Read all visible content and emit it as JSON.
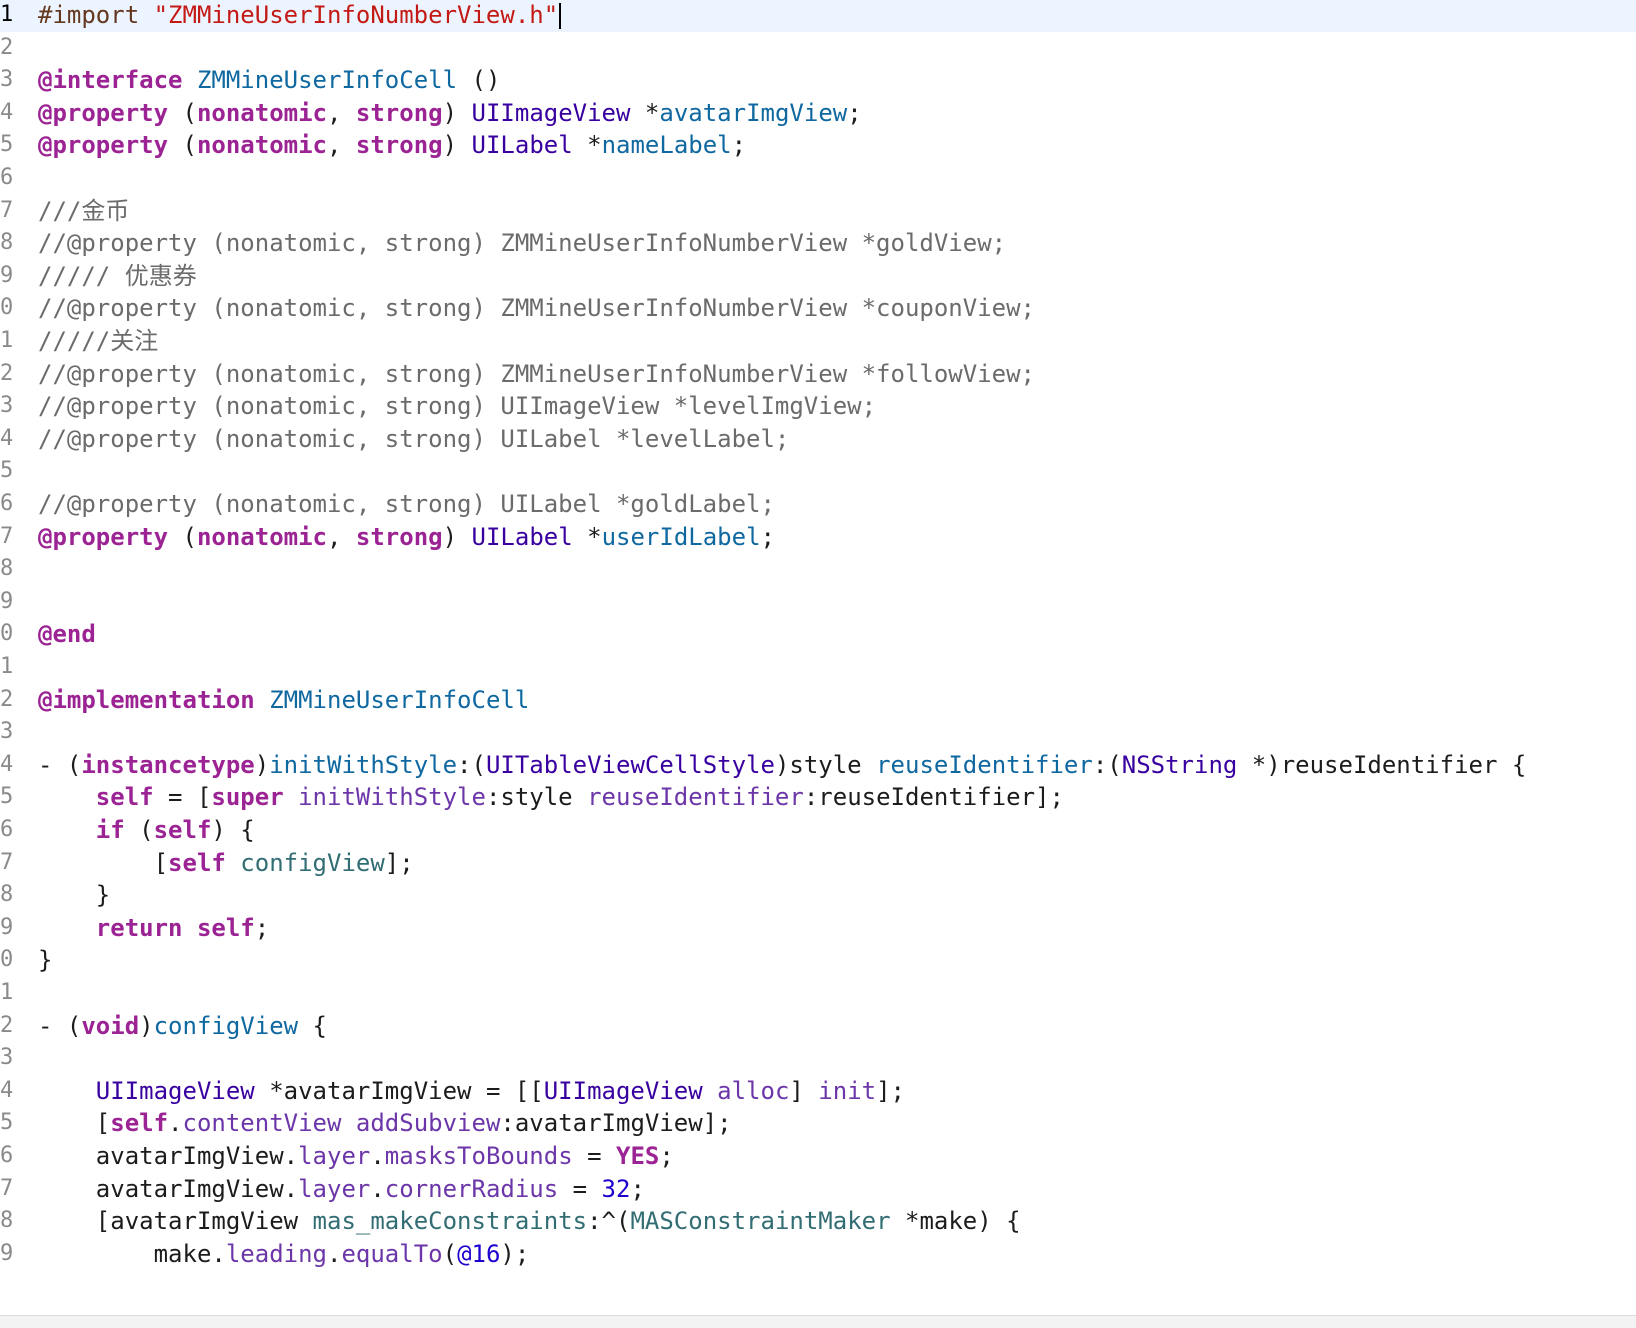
{
  "editor": {
    "current_line": 0,
    "lines": [
      {
        "n": "1",
        "t": [
          {
            "c": "#import ",
            "k": "pre"
          },
          {
            "c": "\"ZMMineUserInfoNumberView.h\"",
            "k": "str"
          }
        ]
      },
      {
        "n": "2",
        "t": []
      },
      {
        "n": "3",
        "t": [
          {
            "c": "@interface",
            "k": "kw"
          },
          {
            "c": " ",
            "k": "pl"
          },
          {
            "c": "ZMMineUserInfoCell",
            "k": "ivar"
          },
          {
            "c": " ()",
            "k": "pl"
          }
        ]
      },
      {
        "n": "4",
        "t": [
          {
            "c": "@property",
            "k": "kw"
          },
          {
            "c": " (",
            "k": "pl"
          },
          {
            "c": "nonatomic",
            "k": "kw"
          },
          {
            "c": ", ",
            "k": "pl"
          },
          {
            "c": "strong",
            "k": "kw"
          },
          {
            "c": ") ",
            "k": "pl"
          },
          {
            "c": "UIImageView",
            "k": "type"
          },
          {
            "c": " *",
            "k": "pl"
          },
          {
            "c": "avatarImgView",
            "k": "ivar"
          },
          {
            "c": ";",
            "k": "pl"
          }
        ]
      },
      {
        "n": "5",
        "t": [
          {
            "c": "@property",
            "k": "kw"
          },
          {
            "c": " (",
            "k": "pl"
          },
          {
            "c": "nonatomic",
            "k": "kw"
          },
          {
            "c": ", ",
            "k": "pl"
          },
          {
            "c": "strong",
            "k": "kw"
          },
          {
            "c": ") ",
            "k": "pl"
          },
          {
            "c": "UILabel",
            "k": "type"
          },
          {
            "c": " *",
            "k": "pl"
          },
          {
            "c": "nameLabel",
            "k": "ivar"
          },
          {
            "c": ";",
            "k": "pl"
          }
        ]
      },
      {
        "n": "6",
        "t": []
      },
      {
        "n": "7",
        "t": [
          {
            "c": "///金币",
            "k": "cm"
          }
        ]
      },
      {
        "n": "8",
        "t": [
          {
            "c": "//@property (nonatomic, strong) ZMMineUserInfoNumberView *goldView;",
            "k": "cm"
          }
        ]
      },
      {
        "n": "9",
        "t": [
          {
            "c": "///// 优惠券",
            "k": "cm"
          }
        ]
      },
      {
        "n": "0",
        "t": [
          {
            "c": "//@property (nonatomic, strong) ZMMineUserInfoNumberView *couponView;",
            "k": "cm"
          }
        ]
      },
      {
        "n": "1",
        "t": [
          {
            "c": "/////关注",
            "k": "cm"
          }
        ]
      },
      {
        "n": "2",
        "t": [
          {
            "c": "//@property (nonatomic, strong) ZMMineUserInfoNumberView *followView;",
            "k": "cm"
          }
        ]
      },
      {
        "n": "3",
        "t": [
          {
            "c": "//@property (nonatomic, strong) UIImageView *levelImgView;",
            "k": "cm"
          }
        ]
      },
      {
        "n": "4",
        "t": [
          {
            "c": "//@property (nonatomic, strong) UILabel *levelLabel;",
            "k": "cm"
          }
        ]
      },
      {
        "n": "5",
        "t": []
      },
      {
        "n": "6",
        "t": [
          {
            "c": "//@property (nonatomic, strong) UILabel *goldLabel;",
            "k": "cm"
          }
        ]
      },
      {
        "n": "7",
        "t": [
          {
            "c": "@property",
            "k": "kw"
          },
          {
            "c": " (",
            "k": "pl"
          },
          {
            "c": "nonatomic",
            "k": "kw"
          },
          {
            "c": ", ",
            "k": "pl"
          },
          {
            "c": "strong",
            "k": "kw"
          },
          {
            "c": ") ",
            "k": "pl"
          },
          {
            "c": "UILabel",
            "k": "type"
          },
          {
            "c": " *",
            "k": "pl"
          },
          {
            "c": "userIdLabel",
            "k": "ivar"
          },
          {
            "c": ";",
            "k": "pl"
          }
        ]
      },
      {
        "n": "8",
        "t": []
      },
      {
        "n": "9",
        "t": []
      },
      {
        "n": "0",
        "t": [
          {
            "c": "@end",
            "k": "kw"
          }
        ]
      },
      {
        "n": "1",
        "t": []
      },
      {
        "n": "2",
        "t": [
          {
            "c": "@implementation",
            "k": "kw"
          },
          {
            "c": " ",
            "k": "pl"
          },
          {
            "c": "ZMMineUserInfoCell",
            "k": "ivar"
          }
        ]
      },
      {
        "n": "3",
        "t": []
      },
      {
        "n": "4",
        "t": [
          {
            "c": "- (",
            "k": "pl"
          },
          {
            "c": "instancetype",
            "k": "kw"
          },
          {
            "c": ")",
            "k": "pl"
          },
          {
            "c": "initWithStyle",
            "k": "ivar"
          },
          {
            "c": ":(",
            "k": "pl"
          },
          {
            "c": "UITableViewCellStyle",
            "k": "type"
          },
          {
            "c": ")style ",
            "k": "pl"
          },
          {
            "c": "reuseIdentifier",
            "k": "ivar"
          },
          {
            "c": ":(",
            "k": "pl"
          },
          {
            "c": "NSString",
            "k": "type"
          },
          {
            "c": " *)reuseIdentifier {",
            "k": "pl"
          }
        ]
      },
      {
        "n": "5",
        "t": [
          {
            "c": "    ",
            "k": "pl"
          },
          {
            "c": "self",
            "k": "kw"
          },
          {
            "c": " = [",
            "k": "pl"
          },
          {
            "c": "super",
            "k": "kw"
          },
          {
            "c": " ",
            "k": "pl"
          },
          {
            "c": "initWithStyle",
            "k": "meth"
          },
          {
            "c": ":style ",
            "k": "pl"
          },
          {
            "c": "reuseIdentifier",
            "k": "meth"
          },
          {
            "c": ":reuseIdentifier];",
            "k": "pl"
          }
        ]
      },
      {
        "n": "6",
        "t": [
          {
            "c": "    ",
            "k": "pl"
          },
          {
            "c": "if",
            "k": "kw"
          },
          {
            "c": " (",
            "k": "pl"
          },
          {
            "c": "self",
            "k": "kw"
          },
          {
            "c": ") {",
            "k": "pl"
          }
        ]
      },
      {
        "n": "7",
        "t": [
          {
            "c": "        [",
            "k": "pl"
          },
          {
            "c": "self",
            "k": "kw"
          },
          {
            "c": " ",
            "k": "pl"
          },
          {
            "c": "configView",
            "k": "prop"
          },
          {
            "c": "];",
            "k": "pl"
          }
        ]
      },
      {
        "n": "8",
        "t": [
          {
            "c": "    }",
            "k": "pl"
          }
        ]
      },
      {
        "n": "9",
        "t": [
          {
            "c": "    ",
            "k": "pl"
          },
          {
            "c": "return",
            "k": "kw"
          },
          {
            "c": " ",
            "k": "pl"
          },
          {
            "c": "self",
            "k": "kw"
          },
          {
            "c": ";",
            "k": "pl"
          }
        ]
      },
      {
        "n": "0",
        "t": [
          {
            "c": "}",
            "k": "pl"
          }
        ]
      },
      {
        "n": "1",
        "t": []
      },
      {
        "n": "2",
        "t": [
          {
            "c": "- (",
            "k": "pl"
          },
          {
            "c": "void",
            "k": "kw"
          },
          {
            "c": ")",
            "k": "pl"
          },
          {
            "c": "configView",
            "k": "ivar"
          },
          {
            "c": " {",
            "k": "pl"
          }
        ]
      },
      {
        "n": "3",
        "t": []
      },
      {
        "n": "4",
        "t": [
          {
            "c": "    ",
            "k": "pl"
          },
          {
            "c": "UIImageView",
            "k": "type"
          },
          {
            "c": " *avatarImgView = [[",
            "k": "pl"
          },
          {
            "c": "UIImageView",
            "k": "type"
          },
          {
            "c": " ",
            "k": "pl"
          },
          {
            "c": "alloc",
            "k": "meth"
          },
          {
            "c": "] ",
            "k": "pl"
          },
          {
            "c": "init",
            "k": "meth"
          },
          {
            "c": "];",
            "k": "pl"
          }
        ]
      },
      {
        "n": "5",
        "t": [
          {
            "c": "    [",
            "k": "pl"
          },
          {
            "c": "self",
            "k": "kw"
          },
          {
            "c": ".",
            "k": "pl"
          },
          {
            "c": "contentView",
            "k": "meth"
          },
          {
            "c": " ",
            "k": "pl"
          },
          {
            "c": "addSubview",
            "k": "meth"
          },
          {
            "c": ":avatarImgView];",
            "k": "pl"
          }
        ]
      },
      {
        "n": "6",
        "t": [
          {
            "c": "    avatarImgView.",
            "k": "pl"
          },
          {
            "c": "layer",
            "k": "meth"
          },
          {
            "c": ".",
            "k": "pl"
          },
          {
            "c": "masksToBounds",
            "k": "meth"
          },
          {
            "c": " = ",
            "k": "pl"
          },
          {
            "c": "YES",
            "k": "kw"
          },
          {
            "c": ";",
            "k": "pl"
          }
        ]
      },
      {
        "n": "7",
        "t": [
          {
            "c": "    avatarImgView.",
            "k": "pl"
          },
          {
            "c": "layer",
            "k": "meth"
          },
          {
            "c": ".",
            "k": "pl"
          },
          {
            "c": "cornerRadius",
            "k": "meth"
          },
          {
            "c": " = ",
            "k": "pl"
          },
          {
            "c": "32",
            "k": "num"
          },
          {
            "c": ";",
            "k": "pl"
          }
        ]
      },
      {
        "n": "8",
        "t": [
          {
            "c": "    [avatarImgView ",
            "k": "pl"
          },
          {
            "c": "mas_makeConstraints",
            "k": "prop"
          },
          {
            "c": ":^(",
            "k": "pl"
          },
          {
            "c": "MASConstraintMaker",
            "k": "prop"
          },
          {
            "c": " *make) {",
            "k": "pl"
          }
        ]
      },
      {
        "n": "9",
        "t": [
          {
            "c": "        make.",
            "k": "pl"
          },
          {
            "c": "leading",
            "k": "meth"
          },
          {
            "c": ".",
            "k": "pl"
          },
          {
            "c": "equalTo",
            "k": "meth"
          },
          {
            "c": "(",
            "k": "pl"
          },
          {
            "c": "@16",
            "k": "num"
          },
          {
            "c": ");",
            "k": "pl"
          }
        ]
      }
    ]
  }
}
